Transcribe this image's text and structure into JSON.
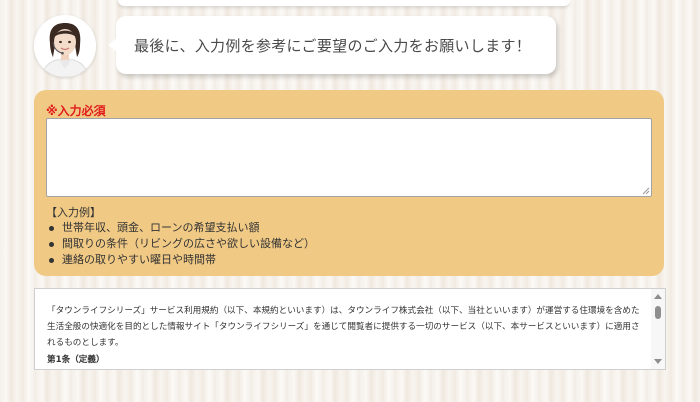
{
  "assistant": {
    "message": "最後に、入力例を参考にご要望のご入力をお願いします！"
  },
  "form": {
    "required_label": "※入力必須",
    "textarea_value": "",
    "example_title": "【入力例】",
    "examples": [
      "世帯年収、頭金、ローンの希望支払い額",
      "間取りの条件（リビングの広さや欲しい設備など）",
      "連絡の取りやすい曜日や時間帯"
    ]
  },
  "terms": {
    "paragraph": "「タウンライフシリーズ」サービス利用規約（以下、本規約といいます）は、タウンライフ株式会社（以下、当社といいます）が運営する住環境を含めた生活全般の快適化を目的とした情報サイト「タウンライフシリーズ」を通じて閲覧者に提供する一切のサービス（以下、本サービスといいます）に適用されるものとします。",
    "heading": "第1条（定義）"
  },
  "colors": {
    "panel": "#f0c985",
    "required": "#e01d1d",
    "bubble_text": "#4a4a4a"
  },
  "icons": {
    "avatar": "operator-avatar-icon",
    "scroll_up": "scroll-up-icon",
    "scroll_down": "scroll-down-icon"
  }
}
